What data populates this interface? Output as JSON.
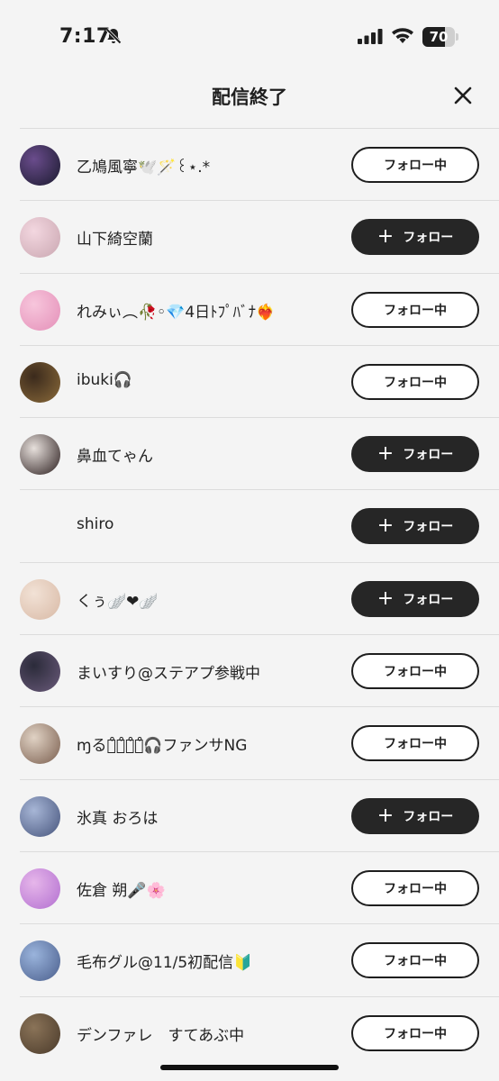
{
  "status": {
    "time": "7:17",
    "battery": "70",
    "battery_level": 0.7
  },
  "header": {
    "title": "配信終了"
  },
  "labels": {
    "following": "フォロー中",
    "follow": "フォロー"
  },
  "rows": [
    {
      "name": "乙鳩風寧🕊️🪄꒰⋆.*",
      "state": "following",
      "avatar": [
        "#6a4c8c",
        "#1a1a2e"
      ]
    },
    {
      "name": "山下綺空蘭",
      "state": "follow",
      "avatar": [
        "#f3d7e0",
        "#c9a6b0"
      ]
    },
    {
      "name": "れみぃ︵🥀◦💎4日ﾄﾌﾟﾊﾞﾅ❤️‍🔥",
      "state": "following",
      "avatar": [
        "#f7c6dc",
        "#e48fb8"
      ]
    },
    {
      "name": "ibuki🎧",
      "state": "following",
      "avatar": [
        "#3b2a1c",
        "#8a6a3a"
      ]
    },
    {
      "name": "鼻血てゃん",
      "state": "follow",
      "avatar": [
        "#e7e0dc",
        "#2a1d1d"
      ]
    },
    {
      "name": "shiro",
      "state": "follow",
      "avatar": null
    },
    {
      "name": "くぅ🪽❤🪽",
      "state": "follow",
      "avatar": [
        "#f2e2d6",
        "#d8b9a5"
      ]
    },
    {
      "name": "まいすり@ステアプ参戦中",
      "state": "following",
      "avatar": [
        "#2b2b3a",
        "#6a5a7a"
      ]
    },
    {
      "name": "ɱるい̊ち̊ゃ̊ん̊🎧ファンサNG",
      "state": "following",
      "avatar": [
        "#e0d2c4",
        "#7a5e4e"
      ]
    },
    {
      "name": "氷真 おろは",
      "state": "follow",
      "avatar": [
        "#a7b6d6",
        "#46547c"
      ]
    },
    {
      "name": "佐倉 朔🎤🌸",
      "state": "following",
      "avatar": [
        "#e6b6ea",
        "#b26fd0"
      ]
    },
    {
      "name": "毛布グル@11/5初配信🔰",
      "state": "following",
      "avatar": [
        "#9ab4dc",
        "#4a5e8c"
      ]
    },
    {
      "name": "デンファレ　すてあぶ中",
      "state": "following",
      "avatar": [
        "#8a7358",
        "#4a3a2a"
      ]
    }
  ]
}
